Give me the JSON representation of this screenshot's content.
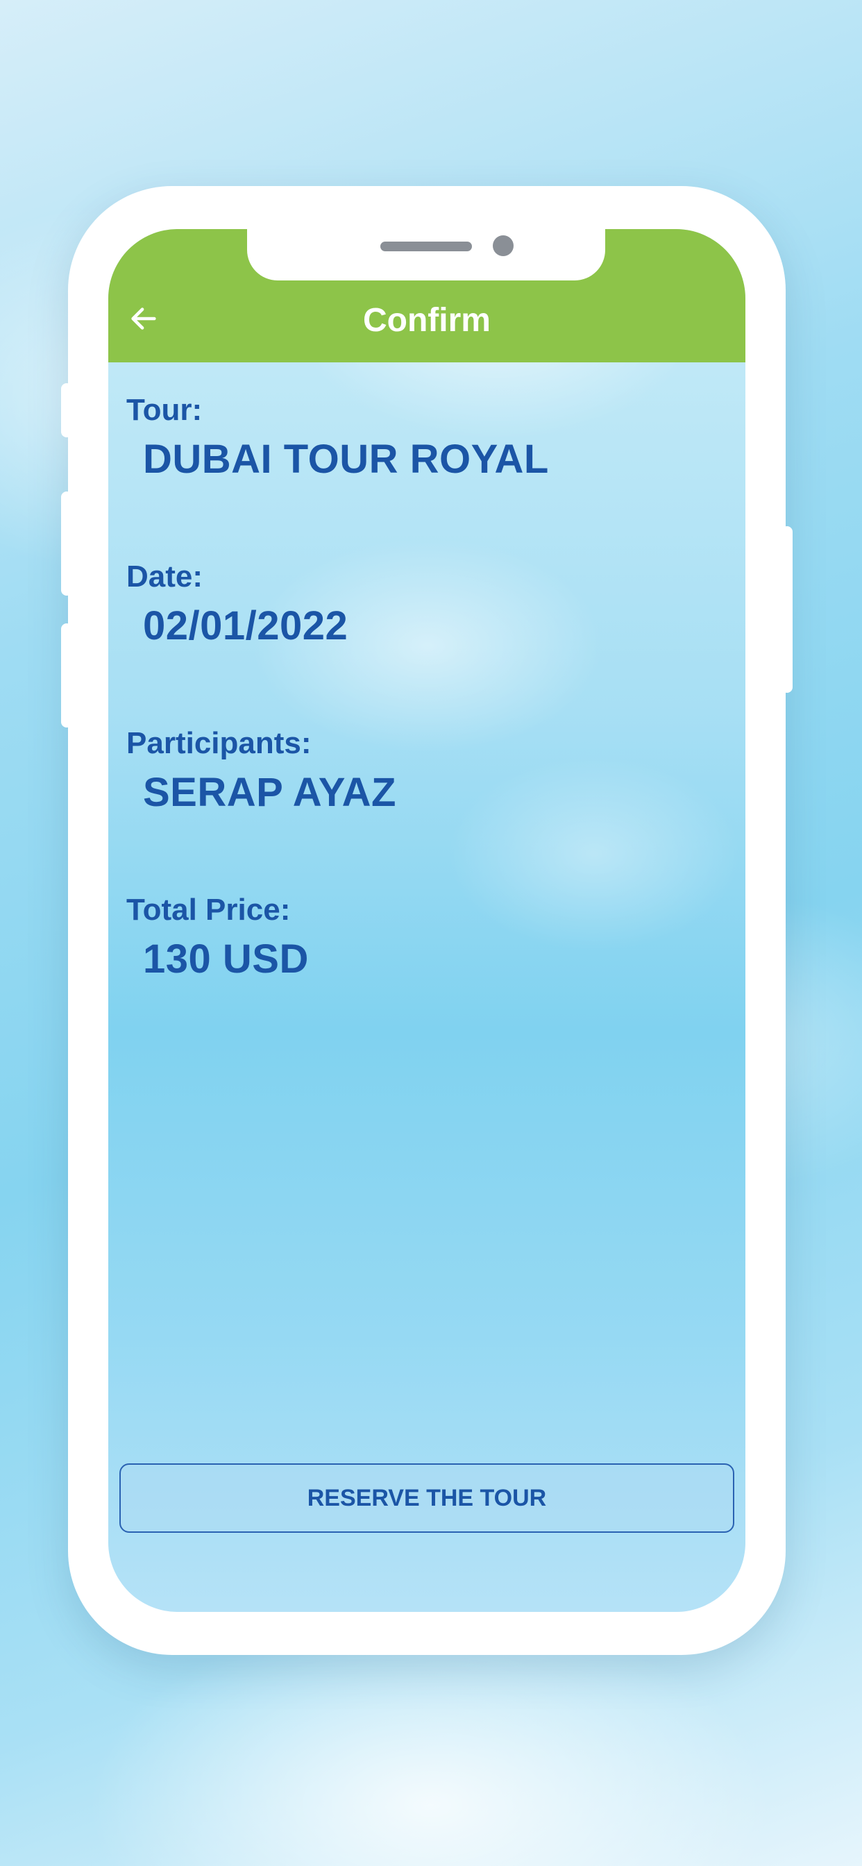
{
  "header": {
    "title": "Confirm",
    "back_icon": "arrow-left-icon"
  },
  "details": [
    {
      "label": "Tour:",
      "value": "DUBAI TOUR ROYAL"
    },
    {
      "label": "Date:",
      "value": "02/01/2022"
    },
    {
      "label": "Participants:",
      "value": "SERAP AYAZ"
    },
    {
      "label": "Total Price:",
      "value": "130 USD"
    }
  ],
  "actions": {
    "reserve_label": "RESERVE THE TOUR"
  },
  "colors": {
    "appbar": "#8dc449",
    "text": "#1b55a6",
    "button_border": "#2a62b2"
  }
}
